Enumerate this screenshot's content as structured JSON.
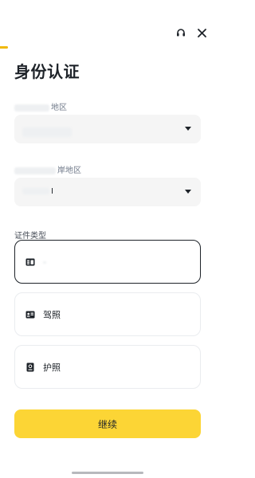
{
  "header": {
    "support_icon": "headset-icon",
    "close_icon": "close-icon",
    "accent_color": "#f0b90b"
  },
  "page": {
    "title": "身份认证"
  },
  "fields": {
    "region": {
      "label": "地区",
      "value": ""
    },
    "residence_region": {
      "label": "岸地区",
      "value": "I"
    }
  },
  "document_type": {
    "label": "证件类型",
    "options": [
      {
        "icon": "id-card-icon",
        "label": "",
        "selected": true
      },
      {
        "icon": "driver-license-icon",
        "label": "驾照",
        "selected": false
      },
      {
        "icon": "passport-icon",
        "label": "护照",
        "selected": false
      }
    ]
  },
  "actions": {
    "continue_label": "继续",
    "button_color": "#fcd535"
  }
}
